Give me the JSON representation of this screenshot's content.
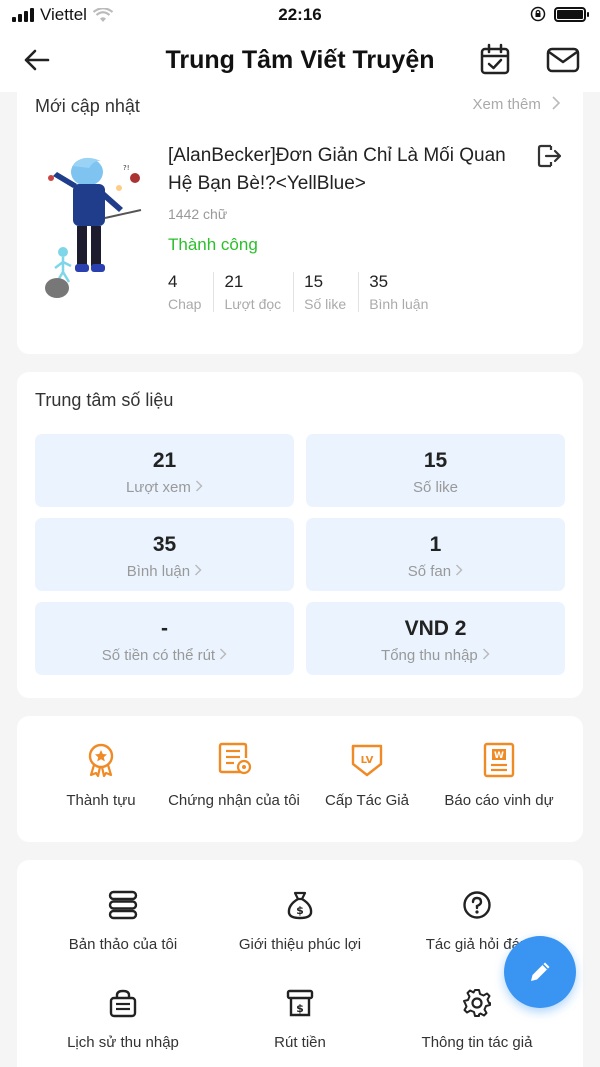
{
  "status_bar": {
    "carrier": "Viettel",
    "time": "22:16"
  },
  "header": {
    "title": "Trung Tâm Viết Truyện"
  },
  "recent": {
    "title": "Mới cập nhật",
    "see_more": "Xem thêm",
    "book": {
      "title": "[AlanBecker]Đơn Giản Chỉ Là Mối Quan Hệ Bạn Bè!?<YellBlue>",
      "word_count": "1442 chữ",
      "state": "Thành công",
      "stats": [
        {
          "value": "4",
          "label": "Chap"
        },
        {
          "value": "21",
          "label": "Lượt đọc"
        },
        {
          "value": "15",
          "label": "Số like"
        },
        {
          "value": "35",
          "label": "Bình luận"
        }
      ]
    }
  },
  "data_center": {
    "title": "Trung tâm số liệu",
    "metrics": [
      {
        "value": "21",
        "label": "Lượt xem"
      },
      {
        "value": "15",
        "label": "Số like"
      },
      {
        "value": "35",
        "label": "Bình luận"
      },
      {
        "value": "1",
        "label": "Số fan"
      },
      {
        "value": "-",
        "label": "Số tiền có thể rút"
      },
      {
        "value": "VND 2",
        "label": "Tổng thu nhập"
      }
    ]
  },
  "features": [
    {
      "label": "Thành tựu",
      "icon": "medal-icon"
    },
    {
      "label": "Chứng nhận của tôi",
      "icon": "certificate-icon"
    },
    {
      "label": "Cấp Tác Giả",
      "icon": "level-badge-icon"
    },
    {
      "label": "Báo cáo vinh dự",
      "icon": "report-icon"
    }
  ],
  "tools": [
    {
      "label": "Bản thảo của tôi",
      "icon": "drafts-icon"
    },
    {
      "label": "Giới thiệu phúc lợi",
      "icon": "money-bag-icon"
    },
    {
      "label": "Tác giả hỏi đáp",
      "icon": "question-icon"
    },
    {
      "label": "Lịch sử thu nhập",
      "icon": "income-history-icon"
    },
    {
      "label": "Rút tiền",
      "icon": "withdraw-icon"
    },
    {
      "label": "Thông tin tác giả",
      "icon": "gear-icon"
    }
  ],
  "colors": {
    "accent": "#3a95f2",
    "orange": "#f08a24",
    "success": "#2bc02b",
    "metric_bg": "#ebf4fe"
  }
}
